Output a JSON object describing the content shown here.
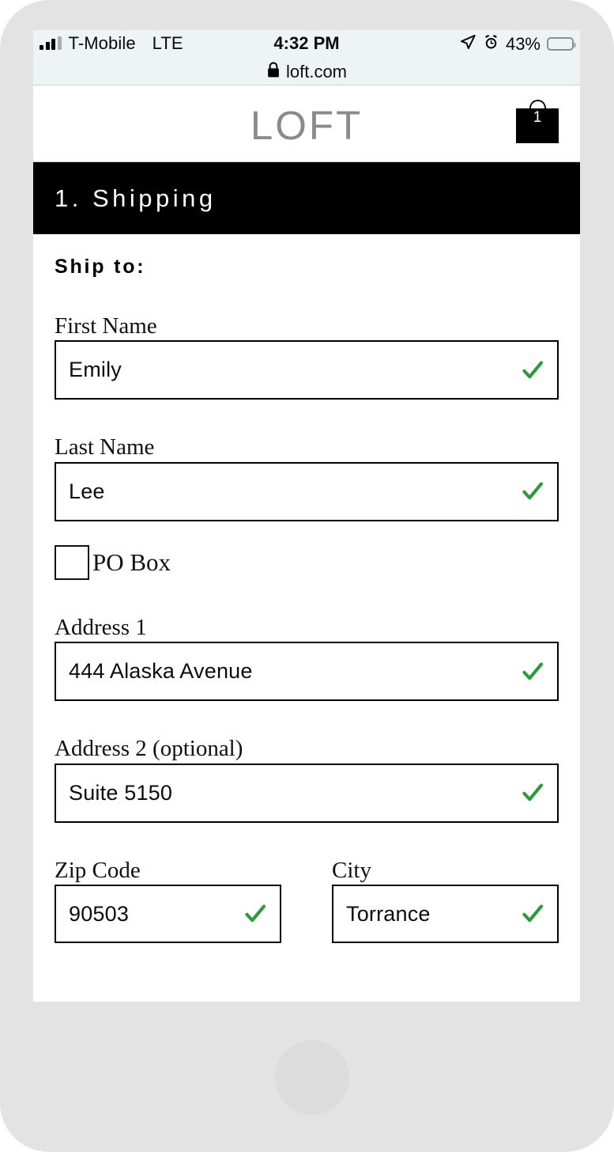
{
  "status_bar": {
    "signal_icon": "signal-bars-icon",
    "carrier": "T-Mobile",
    "network": "LTE",
    "time": "4:32 PM",
    "location_icon": "location-arrow-icon",
    "alarm_icon": "alarm-clock-icon",
    "battery_percent": "43%",
    "battery_color": "#fcc00a",
    "lock_icon": "lock-icon",
    "url": "loft.com"
  },
  "site_header": {
    "logo": "LOFT",
    "cart_icon": "shopping-bag-icon",
    "cart_count": "1"
  },
  "step_banner": {
    "title": "1. Shipping",
    "background": "#000000",
    "text_color": "#ffffff"
  },
  "form": {
    "heading": "Ship to:",
    "valid_icon": "green-check-icon",
    "valid_color": "#2d9b3d",
    "fields": [
      {
        "label": "First Name",
        "value": "Emily",
        "valid": true
      },
      {
        "label": "Last Name",
        "value": "Lee",
        "valid": true
      },
      {
        "label": "Address 1",
        "value": "444 Alaska Avenue",
        "valid": true
      },
      {
        "label": "Address 2 (optional)",
        "value": "Suite 5150",
        "valid": true
      },
      {
        "label": "Zip Code",
        "value": "90503",
        "valid": true
      },
      {
        "label": "City",
        "value": "Torrance",
        "valid": true
      }
    ],
    "po_box": {
      "label": "PO Box",
      "checked": false
    }
  }
}
